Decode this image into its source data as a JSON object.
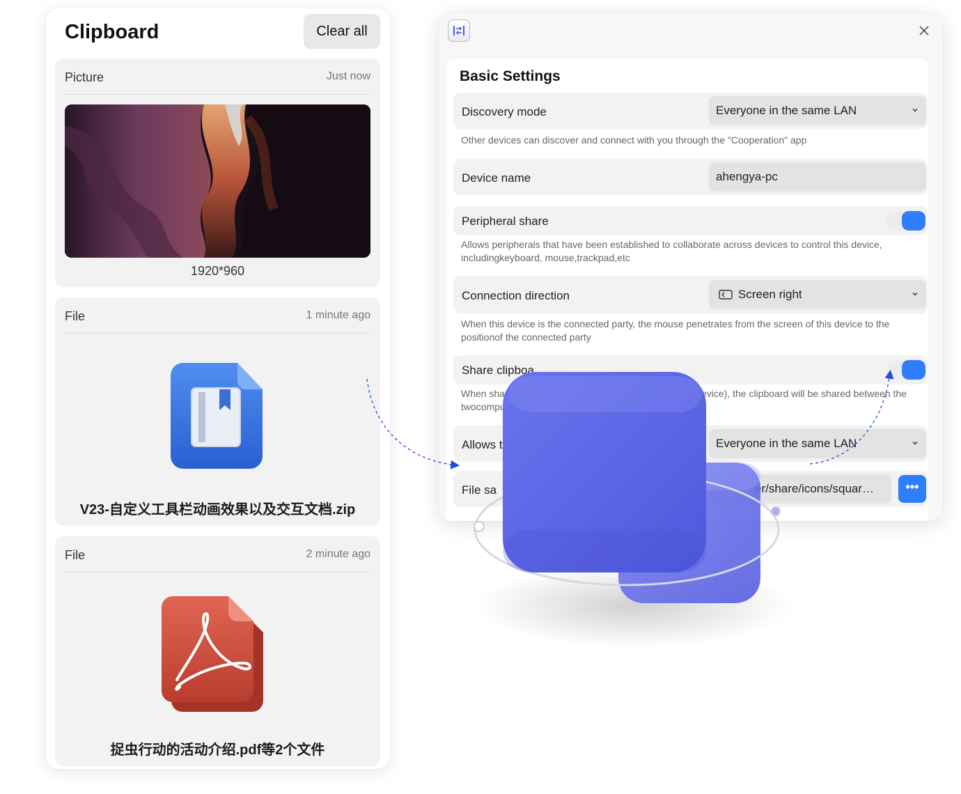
{
  "clipboard": {
    "title": "Clipboard",
    "clear_all": "Clear all",
    "items": [
      {
        "type": "Picture",
        "time": "Just now",
        "dimensions": "1920*960"
      },
      {
        "type": "File",
        "time": "1 minute ago",
        "name": "V23-自定义工具栏动画效果以及交互文档.zip",
        "icon": "book-file-icon"
      },
      {
        "type": "File",
        "time": "2 minute ago",
        "name": "捉虫行动的活动介绍.pdf等2个文件",
        "icon": "pdf-file-icon"
      }
    ]
  },
  "settings": {
    "section_title": "Basic Settings",
    "discovery": {
      "label": "Discovery mode",
      "value": "Everyone in the same LAN",
      "desc": "Other devices can discover and connect with you through the \"Cooperation\" app"
    },
    "device_name": {
      "label": "Device name",
      "value": "ahengya-pc"
    },
    "peripheral": {
      "label": "Peripheral share",
      "enabled": true,
      "desc": "Allows peripherals that have been established to collaborate across devices to control this device, includingkeyboard, mouse,trackpad,etc"
    },
    "direction": {
      "label": "Connection direction",
      "value": "Screen right",
      "desc": "When this device is the connected party, the mouse penetrates from the screen of this device to the positionof the connected party"
    },
    "share_clipboard": {
      "label": "Share clipboa",
      "enabled": true,
      "desc_left": "When shari",
      "desc_right": "evice), the clipboard will be shared between the",
      "desc_line2": "twocompu"
    },
    "allows": {
      "label": "Allows t",
      "value": "Everyone in the same LAN"
    },
    "file_save": {
      "label": "File sa",
      "value": "er/share/icons/squar…",
      "more": "•••"
    }
  },
  "colors": {
    "accent": "#2f7dfa",
    "panel_bg": "#f2f2f2",
    "decor_purple": "#5b66e6"
  }
}
